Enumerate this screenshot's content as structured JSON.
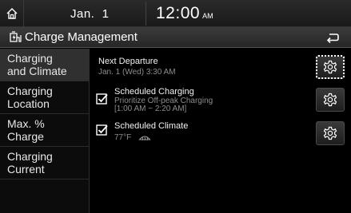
{
  "status": {
    "date": "Jan.  1",
    "time": "12:00",
    "ampm": "AM"
  },
  "header": {
    "title": "Charge Management",
    "icon": "ev-charge-icon",
    "back_icon": "back-icon"
  },
  "sidebar": {
    "items": [
      {
        "line1": "Charging",
        "line2": "and Climate",
        "active": true
      },
      {
        "line1": "Charging",
        "line2": "Location",
        "active": false
      },
      {
        "line1": "Max. %",
        "line2": "Charge",
        "active": false
      },
      {
        "line1": "Charging",
        "line2": "Current",
        "active": false
      }
    ]
  },
  "main": {
    "next_departure": {
      "title": "Next Departure",
      "detail": "Jan. 1 (Wed) 3:30 AM"
    },
    "scheduled_charging": {
      "title": "Scheduled Charging",
      "detail1": "Prioritize Off-peak Charging",
      "detail2": "[1:00 AM ~ 2:20 AM]",
      "checked": true
    },
    "scheduled_climate": {
      "title": "Scheduled Climate",
      "temp": "77°F",
      "checked": true
    }
  },
  "colors": {
    "background": "#000000",
    "active_tab": "#303030",
    "secondary_text": "#8c8c8c"
  }
}
